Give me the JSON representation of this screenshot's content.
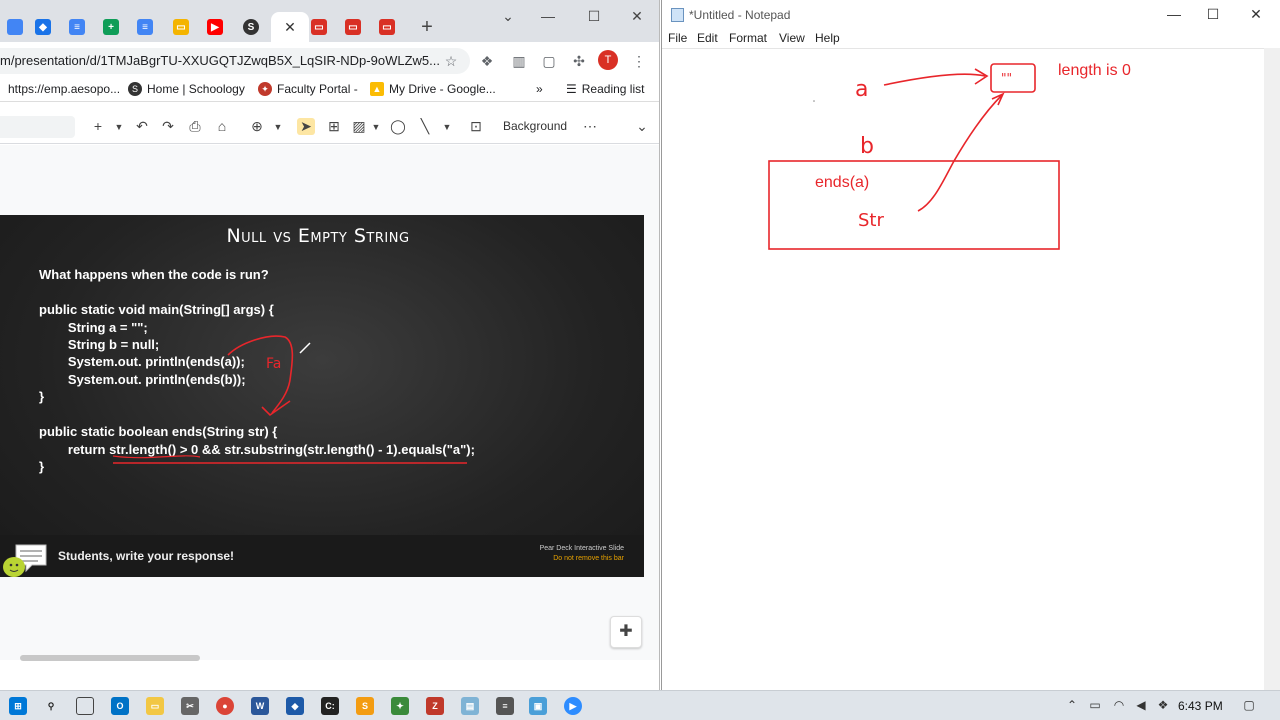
{
  "chrome": {
    "tabs": [
      {
        "icon": "google-slides-icon",
        "color": "#4285f4"
      },
      {
        "icon": "schoology-layers-icon",
        "color": "#1a73e8"
      },
      {
        "icon": "google-docs-icon",
        "color": "#4285f4"
      },
      {
        "icon": "google-sheets-icon",
        "color": "#0f9d58"
      },
      {
        "icon": "google-docs-icon",
        "color": "#4285f4"
      },
      {
        "icon": "google-slides-icon",
        "color": "#f4b400"
      },
      {
        "icon": "youtube-icon",
        "color": "#ff0000"
      },
      {
        "icon": "schoology-icon",
        "color": "#333333"
      },
      {
        "icon": "app-icon",
        "color": "#d93025"
      },
      {
        "icon": "app-icon",
        "color": "#d93025"
      },
      {
        "icon": "app-icon",
        "color": "#d93025"
      }
    ],
    "url": "m/presentation/d/1TMJaBgrTU-XXUGQTJZwqB5X_LqSIR-NDp-9oWLZw5...",
    "avatar_letter": "T",
    "bookmarks": [
      {
        "label": "https://emp.aesopo...",
        "icon": "site-icon"
      },
      {
        "label": "Home | Schoology",
        "icon": "schoology-icon"
      },
      {
        "label": "Faculty Portal -",
        "icon": "portal-icon"
      },
      {
        "label": "My Drive - Google...",
        "icon": "drive-icon"
      }
    ],
    "reading_list": "Reading list",
    "toolbar_background": "Background"
  },
  "slide": {
    "title": "Null vs Empty String",
    "question": "What happens when the code is run?",
    "code_lines": [
      "public static void main(String[] args) {",
      "        String a = \"\";",
      "        String b = null;",
      "        System.out. println(ends(a));",
      "        System.out. println(ends(b));",
      "}",
      "public static boolean ends(String str) {",
      "        return str.length() > 0 && str.substring(str.length() - 1).equals(\"a\");",
      "}"
    ],
    "ink_label": "Fa",
    "peardeck_response": "Students, write your response!",
    "peardeck_note1": "Pear Deck Interactive Slide",
    "peardeck_note2": "Do not remove this bar"
  },
  "notepad": {
    "title": "*Untitled - Notepad",
    "menu": [
      "File",
      "Edit",
      "Format",
      "View",
      "Help"
    ],
    "ink": {
      "label_a": "a",
      "label_b": "b",
      "box_string": "\"\"",
      "length_note": "length is 0",
      "frame_label": "ends(a)",
      "str_label": "Str"
    }
  },
  "taskbar": {
    "clock": "6:43 PM"
  },
  "colors": {
    "ink_red": "#e8262b",
    "chrome_tabstrip": "#dee1e6",
    "taskbar": "#dfe4ea"
  }
}
